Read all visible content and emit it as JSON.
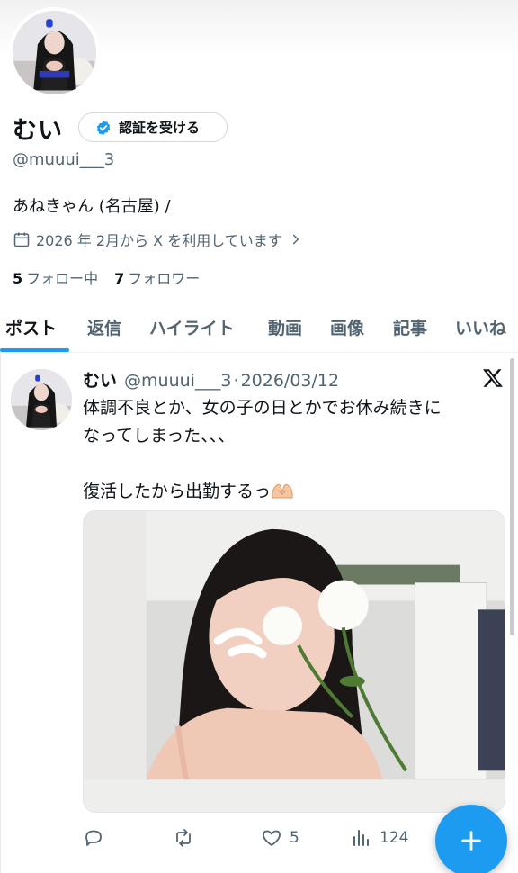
{
  "profile": {
    "display_name": "むい",
    "verify_label": "認証を受ける",
    "handle": "@muuui___3",
    "bio": "あねきゃん (名古屋) /",
    "joined": "2026 年 2月から X を利用しています",
    "following_count": "5",
    "following_label": "フォロー中",
    "followers_count": "7",
    "followers_label": "フォロワー"
  },
  "tabs": [
    {
      "label": "ポスト",
      "active": true
    },
    {
      "label": "返信"
    },
    {
      "label": "ハイライト"
    },
    {
      "label": "動画"
    },
    {
      "label": "画像"
    },
    {
      "label": "記事"
    },
    {
      "label": "いいね"
    }
  ],
  "post": {
    "name": "むい",
    "handle": "@muuui___3",
    "separator": "·",
    "date": "2026/03/12",
    "text_line1": "体調不良とか、女の子の日とかでお休み続きに\nなってしまった、、、",
    "text_line2": "復活したから出勤するっ",
    "reply_count": "",
    "repost_count": "",
    "like_count": "5",
    "view_count": "124"
  },
  "icons": {
    "verified": "verified-badge-icon",
    "calendar": "calendar-icon",
    "reply": "reply-icon",
    "repost": "repost-icon",
    "like": "heart-icon",
    "views": "views-icon",
    "compose": "plus-icon",
    "brand": "x-logo-icon"
  },
  "colors": {
    "accent": "#1d9bf0",
    "text": "#0f1419",
    "secondary": "#536471"
  }
}
